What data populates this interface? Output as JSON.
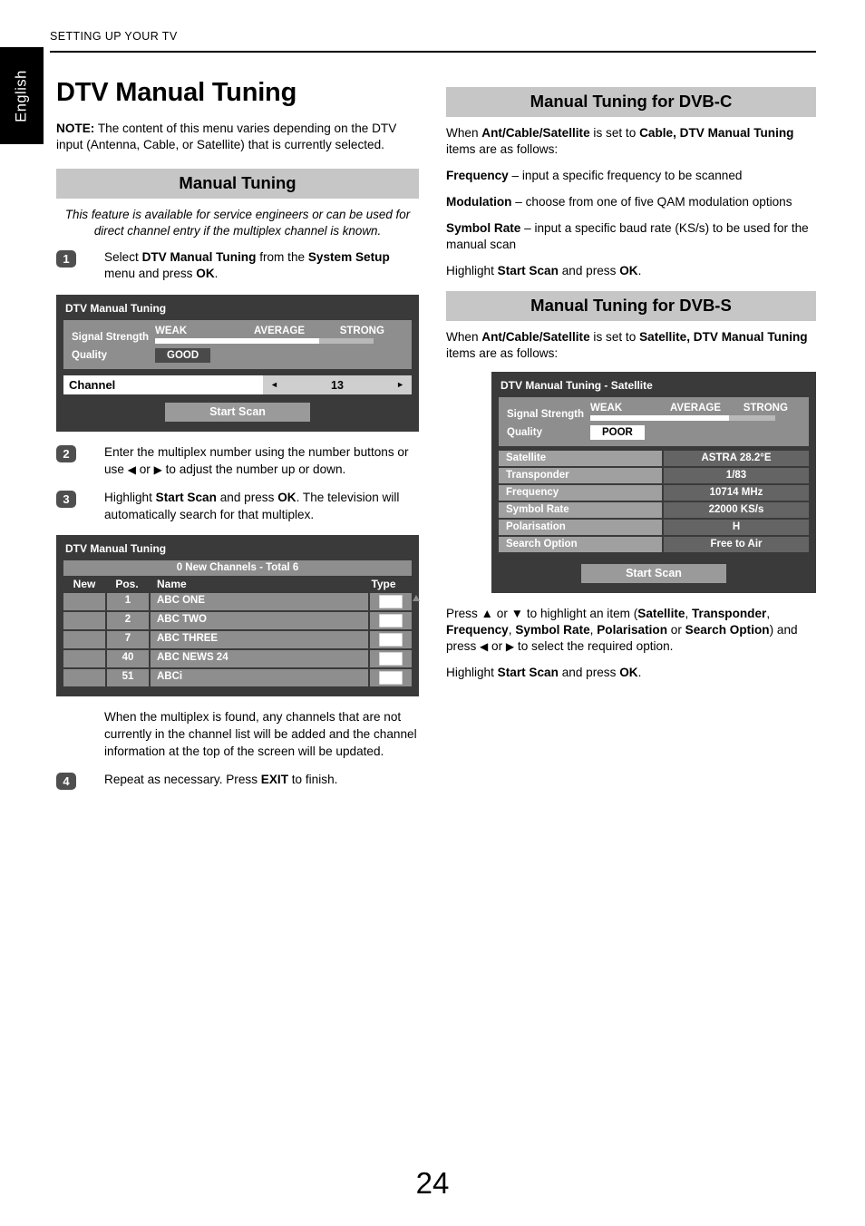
{
  "header": {
    "running_head": "SETTING UP YOUR TV",
    "language_tab": "English"
  },
  "page_number": "24",
  "left": {
    "title": "DTV Manual Tuning",
    "note_label": "NOTE:",
    "note_text": " The content of this menu varies depending on the DTV input (Antenna, Cable, or Satellite) that is currently selected.",
    "section_band": "Manual Tuning",
    "intro": "This feature is available for service engineers or can be used for direct channel entry if the multiplex channel is known.",
    "steps": [
      {
        "num": "1",
        "text_parts": [
          "Select ",
          "DTV Manual Tuning",
          " from the ",
          "System Setup",
          " menu and press ",
          "OK",
          "."
        ]
      },
      {
        "num": "2",
        "text_parts": [
          "Enter the multiplex number using the number buttons or use ",
          "◀",
          " or ",
          "▶",
          " to adjust the number up or down."
        ]
      },
      {
        "num": "3",
        "text_parts": [
          "Highlight ",
          "Start Scan",
          " and press ",
          "OK",
          ". The television will automatically search for that multiplex."
        ]
      },
      {
        "num": "4",
        "text_parts": [
          "Repeat as necessary. Press ",
          "EXIT",
          " to finish."
        ]
      }
    ],
    "after_table_text": "When the multiplex is found, any channels that are not currently in the channel list will be added and the channel information at the top of the screen will be updated.",
    "osd_tuning": {
      "title": "DTV Manual Tuning",
      "signal_label": "Signal Strength",
      "scale": {
        "weak": "WEAK",
        "average": "AVERAGE",
        "strong": "STRONG"
      },
      "signal_fill_percent": 75,
      "quality_label": "Quality",
      "quality_value": "GOOD",
      "quality_style": "dark",
      "channel_label": "Channel",
      "channel_value": "13",
      "left_arrow": "◄",
      "right_arrow": "►",
      "start_scan": "Start Scan"
    },
    "osd_channels": {
      "title": "DTV Manual Tuning",
      "total_bar": "0 New Channels - Total 6",
      "columns": [
        "New",
        "Pos.",
        "Name",
        "Type"
      ],
      "rows": [
        {
          "new": "",
          "pos": "1",
          "name": "ABC ONE",
          "type": "tv-icon"
        },
        {
          "new": "",
          "pos": "2",
          "name": "ABC TWO",
          "type": "tv-icon"
        },
        {
          "new": "",
          "pos": "7",
          "name": "ABC THREE",
          "type": "tv-icon"
        },
        {
          "new": "",
          "pos": "40",
          "name": "ABC NEWS 24",
          "type": "tv-icon"
        },
        {
          "new": "",
          "pos": "51",
          "name": "ABCi",
          "type": "tv-icon"
        }
      ]
    }
  },
  "right": {
    "dvbc": {
      "band": "Manual Tuning for DVB-C",
      "intro_parts": [
        "When ",
        "Ant/Cable/Satellite",
        " is set to ",
        "Cable, DTV Manual Tuning",
        " items are as follows:"
      ],
      "items": [
        {
          "term": "Frequency",
          "desc": " – input a specific frequency to be scanned"
        },
        {
          "term": "Modulation",
          "desc": " – choose from one of five QAM modulation options"
        },
        {
          "term": "Symbol Rate",
          "desc": " – input a specific baud rate (KS/s) to be used for the manual scan"
        }
      ],
      "highlight_parts": [
        "Highlight ",
        "Start Scan",
        " and press ",
        "OK",
        "."
      ]
    },
    "dvbs": {
      "band": "Manual Tuning for DVB-S",
      "intro_parts": [
        "When ",
        "Ant/Cable/Satellite",
        " is set to ",
        "Satellite, DTV Manual Tuning",
        " items are as follows:"
      ],
      "osd": {
        "title": "DTV Manual Tuning - Satellite",
        "signal_label": "Signal Strength",
        "scale": {
          "weak": "WEAK",
          "average": "AVERAGE",
          "strong": "STRONG"
        },
        "signal_fill_percent": 75,
        "quality_label": "Quality",
        "quality_value": "POOR",
        "quality_style": "light",
        "rows": [
          {
            "key": "Satellite",
            "value": "ASTRA 28.2°E"
          },
          {
            "key": "Transponder",
            "value": "1/83"
          },
          {
            "key": "Frequency",
            "value": "10714 MHz"
          },
          {
            "key": "Symbol Rate",
            "value": "22000 KS/s"
          },
          {
            "key": "Polarisation",
            "value": "H"
          },
          {
            "key": "Search Option",
            "value": "Free to Air"
          }
        ],
        "start_scan": "Start Scan"
      },
      "press_parts": [
        "Press ",
        "▲",
        " or ",
        "▼",
        " to highlight an item (",
        "Satellite",
        ", ",
        "Transponder",
        ", ",
        "Frequency",
        ", ",
        "Symbol Rate",
        ", ",
        "Polarisation",
        " or ",
        "Search Option",
        ") and press ",
        "◀",
        " or ",
        "▶",
        " to select the required option."
      ],
      "highlight_parts": [
        "Highlight ",
        "Start Scan",
        " and press ",
        "OK",
        "."
      ]
    }
  },
  "colors": {
    "band_gray": "#c6c6c6",
    "osd_background": "#3a3a3a",
    "osd_panel": "#8e8e8e",
    "osd_row_key": "#a0a0a0",
    "osd_row_value": "#646464",
    "signal_fill": "#ffffff",
    "signal_track": "#b9b9b9"
  }
}
